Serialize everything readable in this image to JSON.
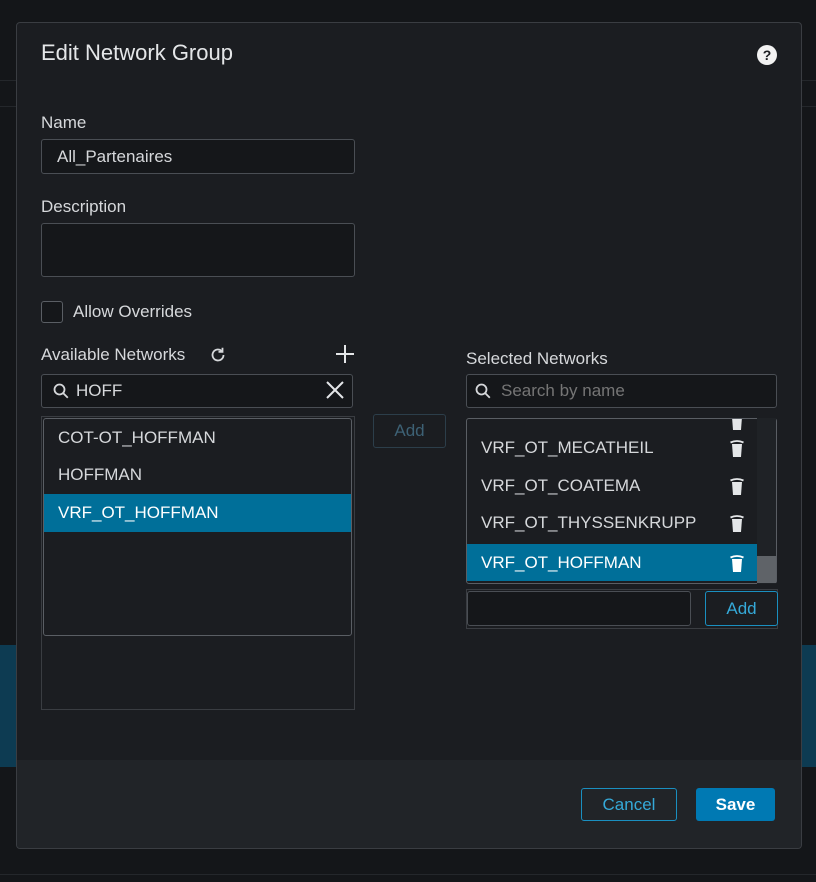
{
  "dialog": {
    "title": "Edit Network Group",
    "help": "?"
  },
  "form": {
    "name_label": "Name",
    "name_value": "All_Partenaires",
    "description_label": "Description",
    "description_value": "",
    "allow_overrides_label": "Allow Overrides",
    "allow_overrides_checked": false
  },
  "available": {
    "label": "Available Networks",
    "search_value": "HOFF",
    "items": [
      {
        "label": "COT-OT_HOFFMAN",
        "selected": false
      },
      {
        "label": "HOFFMAN",
        "selected": false
      },
      {
        "label": "VRF_OT_HOFFMAN",
        "selected": true
      }
    ],
    "add_label": "Add"
  },
  "selected": {
    "label": "Selected Networks",
    "search_placeholder": "Search by name",
    "items": [
      {
        "label": "VRF_OT_MECATHEIL",
        "selected": false
      },
      {
        "label": "VRF_OT_COATEMA",
        "selected": false
      },
      {
        "label": "VRF_OT_THYSSENKRUPP",
        "selected": false
      },
      {
        "label": "VRF_OT_HOFFMAN",
        "selected": true
      }
    ],
    "add_label": "Add"
  },
  "footer": {
    "cancel_label": "Cancel",
    "save_label": "Save"
  },
  "colors": {
    "accent": "#006f99",
    "primary_button": "#0079b3",
    "link": "#35a9d8"
  }
}
